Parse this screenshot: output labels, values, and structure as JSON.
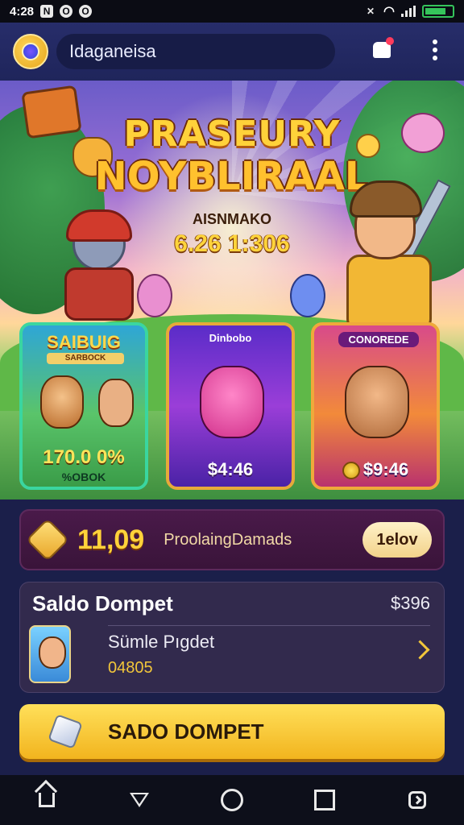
{
  "status_bar": {
    "time": "4:28",
    "left_icons": [
      "N",
      "O",
      "O"
    ]
  },
  "app_bar": {
    "title": "Idaganeisa"
  },
  "hero": {
    "title_line1": "PRASEURY",
    "title_line2": "NOYBLIRAAL",
    "subtitle": "AISNMAKO",
    "timer": "6.26 1:306"
  },
  "cards": [
    {
      "title": "SAIBUIG",
      "subtitle": "SARBOCK",
      "price": "170.0 0%",
      "footer": "%OBOK"
    },
    {
      "title": "Dinbobo",
      "price": "$4:46"
    },
    {
      "title": "CONOREDE",
      "price": "$9:46"
    }
  ],
  "points": {
    "value": "11,09",
    "label": "ProolaingDamads",
    "button": "1elov"
  },
  "wallet": {
    "title": "Saldo Dompet",
    "amount": "$396",
    "item_name": "Sümle Pıgdet",
    "item_value": "04805"
  },
  "cta": {
    "label": "SADO DOMPET"
  },
  "colors": {
    "accent": "#ffd23a",
    "background": "#1b1f4a",
    "cta": "#f2b41e"
  }
}
